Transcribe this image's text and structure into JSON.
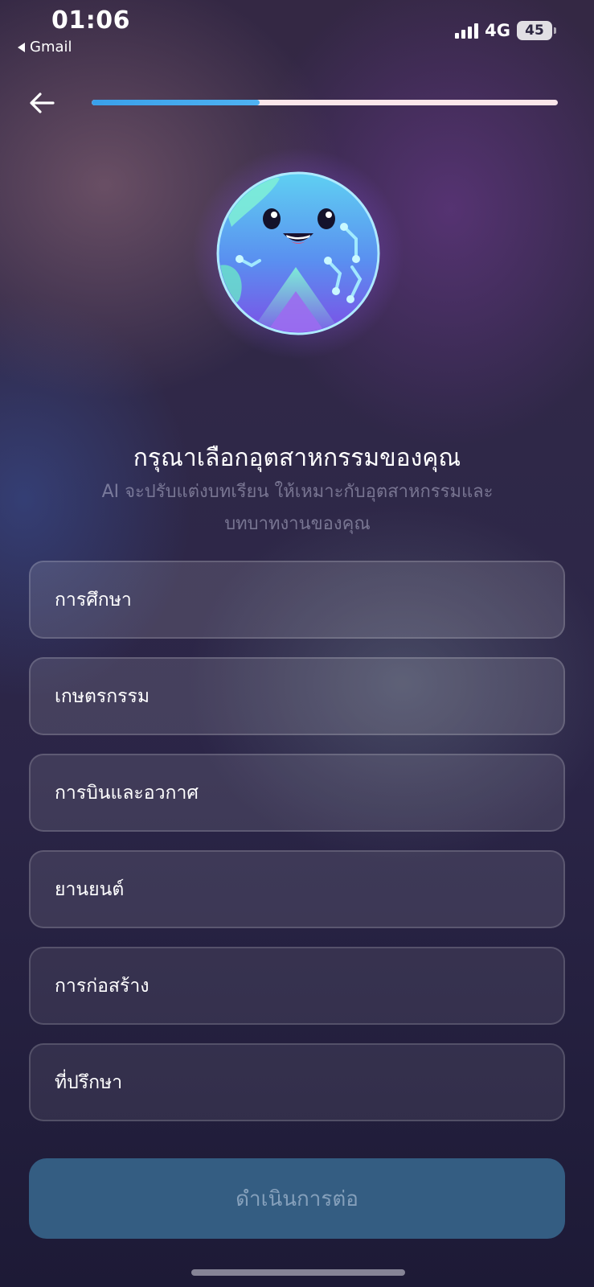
{
  "status_bar": {
    "time": "01:06",
    "back_app": "Gmail",
    "network": "4G",
    "battery": "45"
  },
  "header": {
    "progress_percent": 36
  },
  "title": "กรุณาเลือกอุตสาหกรรมของคุณ",
  "subtitle": "AI จะปรับแต่งบทเรียน ให้เหมาะกับอุตสาหกรรมและบทบาทงานของคุณ",
  "options": [
    {
      "label": "การศึกษา"
    },
    {
      "label": "เกษตรกรรม"
    },
    {
      "label": "การบินและอวกาศ"
    },
    {
      "label": "ยานยนต์"
    },
    {
      "label": "การก่อสร้าง"
    },
    {
      "label": "ที่ปรึกษา"
    }
  ],
  "continue_label": "ดำเนินการต่อ",
  "colors": {
    "progress_fill": "#3aa0ea",
    "progress_track": "#fbe6ea",
    "continue_bg": "#345d82"
  },
  "icons": {
    "back": "arrow-left-icon",
    "mascot": "globe-mascot-icon"
  }
}
